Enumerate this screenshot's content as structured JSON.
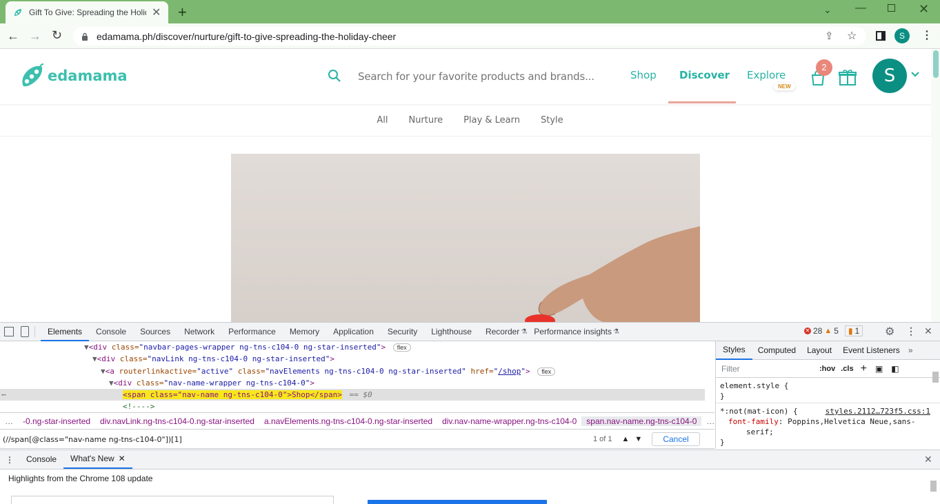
{
  "browser": {
    "tab_title": "Gift To Give: Spreading the Holid",
    "url": "edamama.ph/discover/nurture/gift-to-give-spreading-the-holiday-cheer",
    "profile_initial": "S"
  },
  "site": {
    "logo": "edamama",
    "search_placeholder": "Search for your favorite products and brands...",
    "nav": {
      "shop": "Shop",
      "discover": "Discover",
      "explore": "Explore",
      "new_badge": "NEW"
    },
    "cart_count": "2",
    "avatar_initial": "S",
    "subnav": [
      "All",
      "Nurture",
      "Play & Learn",
      "Style"
    ]
  },
  "devtools": {
    "tabs": [
      "Elements",
      "Console",
      "Sources",
      "Network",
      "Performance",
      "Memory",
      "Application",
      "Security",
      "Lighthouse",
      "Recorder",
      "Performance insights"
    ],
    "errors": "28",
    "warnings": "5",
    "issues": "1",
    "dom": {
      "l1_tag": "<div",
      "l1_attr": " class=",
      "l1_val": "\"navbar-pages-wrapper ng-tns-c104-0 ng-star-inserted\"",
      "l1_end": ">",
      "flex": "flex",
      "l2_tag": "<div",
      "l2_attr": " class=",
      "l2_val": "\"navLink ng-tns-c104-0 ng-star-inserted\"",
      "l2_end": ">",
      "l3_tag": "<a",
      "l3_attr1": " routerlinkactive=",
      "l3_val1": "\"active\"",
      "l3_attr2": " class=",
      "l3_val2": "\"navElements ng-tns-c104-0 ng-star-inserted\"",
      "l3_attr3": " href=",
      "l3_val3_pre": "\"",
      "l3_link": "/shop",
      "l3_val3_post": "\"",
      "l3_end": ">",
      "l4_tag": "<div",
      "l4_attr": " class=",
      "l4_val": "\"nav-name-wrapper ng-tns-c104-0\"",
      "l4_end": ">",
      "l5_text": "<span class=\"nav-name ng-tns-c104-0\">Shop</span>",
      "l5_eq": "== $0",
      "l6_comment": "<!---->"
    },
    "breadcrumbs": [
      "-0.ng-star-inserted",
      "div.navLink.ng-tns-c104-0.ng-star-inserted",
      "a.navElements.ng-tns-c104-0.ng-star-inserted",
      "div.nav-name-wrapper.ng-tns-c104-0",
      "span.nav-name.ng-tns-c104-0"
    ],
    "search_query": "(//span[@class=\"nav-name ng-tns-c104-0\"])[1]",
    "search_count": "1 of 1",
    "cancel": "Cancel",
    "styles_tabs": [
      "Styles",
      "Computed",
      "Layout",
      "Event Listeners"
    ],
    "filter_placeholder": "Filter",
    "hov": ":hov",
    "cls": ".cls",
    "rule1_selector": "element.style {",
    "rule_close": "}",
    "rule2_selector": "*:not(mat-icon) {",
    "rule2_source": "styles.2112…723f5.css:1",
    "rule2_prop": "font-family",
    "rule2_colon": ": ",
    "rule2_value": "Poppins,Helvetica Neue,sans-",
    "rule2_value2": "serif;",
    "drawer_tabs": [
      "Console",
      "What's New"
    ],
    "whats_new": "Highlights from the Chrome 108 update"
  },
  "colors": {
    "accent": "#26b3a4",
    "devtools_blue": "#1a73e8",
    "chrome_green": "#7cb86f"
  }
}
